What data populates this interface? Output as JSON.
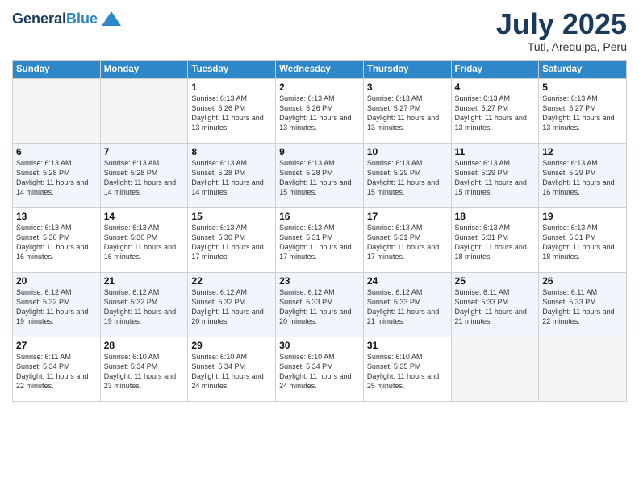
{
  "logo": {
    "line1": "General",
    "line2": "Blue"
  },
  "title": "July 2025",
  "location": "Tuti, Arequipa, Peru",
  "days_of_week": [
    "Sunday",
    "Monday",
    "Tuesday",
    "Wednesday",
    "Thursday",
    "Friday",
    "Saturday"
  ],
  "weeks": [
    [
      {
        "day": "",
        "detail": ""
      },
      {
        "day": "",
        "detail": ""
      },
      {
        "day": "1",
        "detail": "Sunrise: 6:13 AM\nSunset: 5:26 PM\nDaylight: 11 hours and 13 minutes."
      },
      {
        "day": "2",
        "detail": "Sunrise: 6:13 AM\nSunset: 5:26 PM\nDaylight: 11 hours and 13 minutes."
      },
      {
        "day": "3",
        "detail": "Sunrise: 6:13 AM\nSunset: 5:27 PM\nDaylight: 11 hours and 13 minutes."
      },
      {
        "day": "4",
        "detail": "Sunrise: 6:13 AM\nSunset: 5:27 PM\nDaylight: 11 hours and 13 minutes."
      },
      {
        "day": "5",
        "detail": "Sunrise: 6:13 AM\nSunset: 5:27 PM\nDaylight: 11 hours and 13 minutes."
      }
    ],
    [
      {
        "day": "6",
        "detail": "Sunrise: 6:13 AM\nSunset: 5:28 PM\nDaylight: 11 hours and 14 minutes."
      },
      {
        "day": "7",
        "detail": "Sunrise: 6:13 AM\nSunset: 5:28 PM\nDaylight: 11 hours and 14 minutes."
      },
      {
        "day": "8",
        "detail": "Sunrise: 6:13 AM\nSunset: 5:28 PM\nDaylight: 11 hours and 14 minutes."
      },
      {
        "day": "9",
        "detail": "Sunrise: 6:13 AM\nSunset: 5:28 PM\nDaylight: 11 hours and 15 minutes."
      },
      {
        "day": "10",
        "detail": "Sunrise: 6:13 AM\nSunset: 5:29 PM\nDaylight: 11 hours and 15 minutes."
      },
      {
        "day": "11",
        "detail": "Sunrise: 6:13 AM\nSunset: 5:29 PM\nDaylight: 11 hours and 15 minutes."
      },
      {
        "day": "12",
        "detail": "Sunrise: 6:13 AM\nSunset: 5:29 PM\nDaylight: 11 hours and 16 minutes."
      }
    ],
    [
      {
        "day": "13",
        "detail": "Sunrise: 6:13 AM\nSunset: 5:30 PM\nDaylight: 11 hours and 16 minutes."
      },
      {
        "day": "14",
        "detail": "Sunrise: 6:13 AM\nSunset: 5:30 PM\nDaylight: 11 hours and 16 minutes."
      },
      {
        "day": "15",
        "detail": "Sunrise: 6:13 AM\nSunset: 5:30 PM\nDaylight: 11 hours and 17 minutes."
      },
      {
        "day": "16",
        "detail": "Sunrise: 6:13 AM\nSunset: 5:31 PM\nDaylight: 11 hours and 17 minutes."
      },
      {
        "day": "17",
        "detail": "Sunrise: 6:13 AM\nSunset: 5:31 PM\nDaylight: 11 hours and 17 minutes."
      },
      {
        "day": "18",
        "detail": "Sunrise: 6:13 AM\nSunset: 5:31 PM\nDaylight: 11 hours and 18 minutes."
      },
      {
        "day": "19",
        "detail": "Sunrise: 6:13 AM\nSunset: 5:31 PM\nDaylight: 11 hours and 18 minutes."
      }
    ],
    [
      {
        "day": "20",
        "detail": "Sunrise: 6:12 AM\nSunset: 5:32 PM\nDaylight: 11 hours and 19 minutes."
      },
      {
        "day": "21",
        "detail": "Sunrise: 6:12 AM\nSunset: 5:32 PM\nDaylight: 11 hours and 19 minutes."
      },
      {
        "day": "22",
        "detail": "Sunrise: 6:12 AM\nSunset: 5:32 PM\nDaylight: 11 hours and 20 minutes."
      },
      {
        "day": "23",
        "detail": "Sunrise: 6:12 AM\nSunset: 5:33 PM\nDaylight: 11 hours and 20 minutes."
      },
      {
        "day": "24",
        "detail": "Sunrise: 6:12 AM\nSunset: 5:33 PM\nDaylight: 11 hours and 21 minutes."
      },
      {
        "day": "25",
        "detail": "Sunrise: 6:11 AM\nSunset: 5:33 PM\nDaylight: 11 hours and 21 minutes."
      },
      {
        "day": "26",
        "detail": "Sunrise: 6:11 AM\nSunset: 5:33 PM\nDaylight: 11 hours and 22 minutes."
      }
    ],
    [
      {
        "day": "27",
        "detail": "Sunrise: 6:11 AM\nSunset: 5:34 PM\nDaylight: 11 hours and 22 minutes."
      },
      {
        "day": "28",
        "detail": "Sunrise: 6:10 AM\nSunset: 5:34 PM\nDaylight: 11 hours and 23 minutes."
      },
      {
        "day": "29",
        "detail": "Sunrise: 6:10 AM\nSunset: 5:34 PM\nDaylight: 11 hours and 24 minutes."
      },
      {
        "day": "30",
        "detail": "Sunrise: 6:10 AM\nSunset: 5:34 PM\nDaylight: 11 hours and 24 minutes."
      },
      {
        "day": "31",
        "detail": "Sunrise: 6:10 AM\nSunset: 5:35 PM\nDaylight: 11 hours and 25 minutes."
      },
      {
        "day": "",
        "detail": ""
      },
      {
        "day": "",
        "detail": ""
      }
    ]
  ]
}
